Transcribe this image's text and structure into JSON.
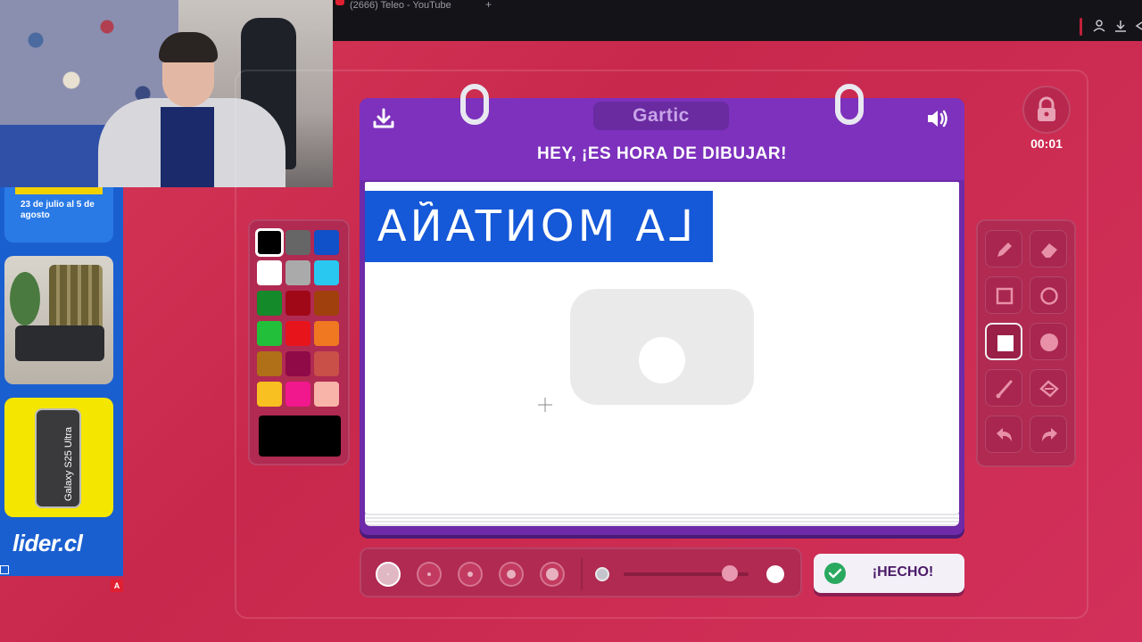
{
  "browser": {
    "tab_title": "(2666) Teleo - YouTube",
    "tab_plus": "+"
  },
  "ads": {
    "date_text": "23 de julio al 5 de agosto",
    "phone_text": "Galaxy S25 Ultra",
    "brand": "lider.cl",
    "marker": "A"
  },
  "game": {
    "logo": "Gartic",
    "prompt": "HEY, ¡ES HORA DE DIBUJAR!",
    "drawing_text": "LA MONTAÑA",
    "timer": "00:01",
    "done_label": "¡HECHO!"
  },
  "palette": {
    "colors": [
      "#000000",
      "#666666",
      "#1050c8",
      "#ffffff",
      "#aaaaaa",
      "#28c8f0",
      "#148a2a",
      "#a00818",
      "#a0400c",
      "#22c03a",
      "#e8141c",
      "#f07820",
      "#b07018",
      "#900a48",
      "#c85048",
      "#f8c020",
      "#f0188c",
      "#f8b4a8"
    ],
    "selected": "#000000",
    "current": "#000000"
  },
  "tools": [
    "pencil",
    "eraser",
    "rectangle-outline",
    "circle-outline",
    "rectangle-fill",
    "circle-fill",
    "line",
    "fill-bucket",
    "undo",
    "redo"
  ],
  "active_tool": "rectangle-fill",
  "brush_sizes": [
    1,
    2,
    3,
    4,
    5
  ],
  "active_brush_size": 1,
  "opacity": 0.85
}
